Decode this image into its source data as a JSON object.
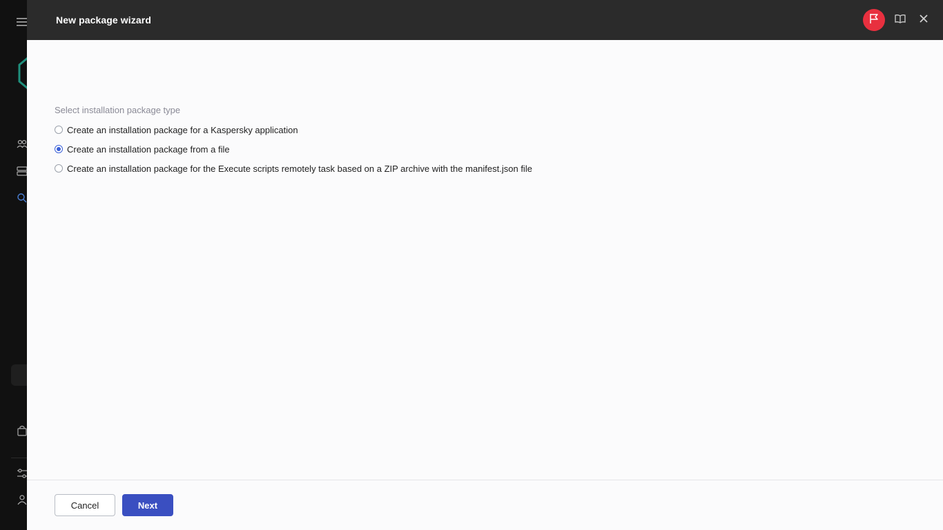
{
  "wizard": {
    "title": "New package wizard"
  },
  "body": {
    "section_label": "Select installation package type",
    "options": [
      {
        "label": "Create an installation package for a Kaspersky application",
        "checked": false
      },
      {
        "label": "Create an installation package from a file",
        "checked": true
      },
      {
        "label": "Create an installation package for the Execute scripts remotely task based on a ZIP archive with the manifest.json file",
        "checked": false
      }
    ]
  },
  "footer": {
    "cancel_label": "Cancel",
    "next_label": "Next"
  },
  "colors": {
    "header_bg": "#2b2b2b",
    "flag_button": "#e8303f",
    "primary_button": "#3a4fc1",
    "radio_checked": "#3a60d8"
  },
  "icons": {
    "header": [
      "flag-icon",
      "book-icon",
      "close-icon"
    ],
    "background_nav": [
      "menu-icon",
      "logo-icon",
      "users-icon",
      "servers-icon",
      "search-icon",
      "bag-icon",
      "settings-sliders-icon",
      "user-icon"
    ]
  }
}
